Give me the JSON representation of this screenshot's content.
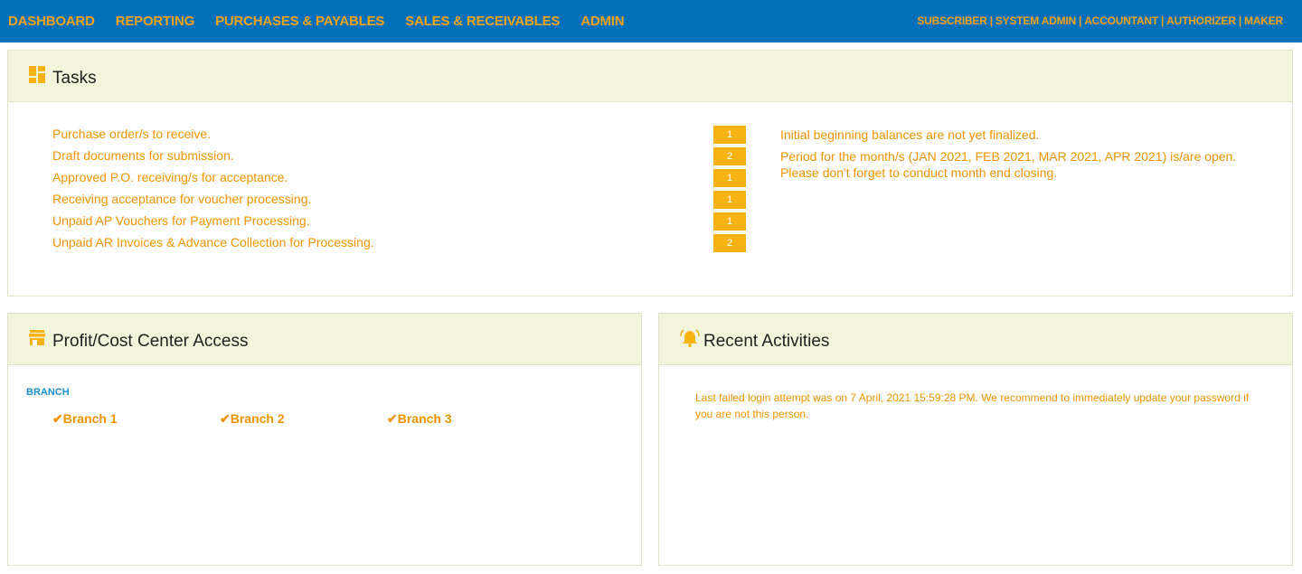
{
  "nav": {
    "items": [
      {
        "label": "DASHBOARD"
      },
      {
        "label": "REPORTING"
      },
      {
        "label": "PURCHASES & PAYABLES"
      },
      {
        "label": "SALES & RECEIVABLES"
      },
      {
        "label": "ADMIN"
      }
    ],
    "roles": [
      "SUBSCRIBER",
      "SYSTEM ADMIN",
      "ACCOUNTANT",
      "AUTHORIZER",
      "MAKER"
    ],
    "role_separator": "|"
  },
  "tasks": {
    "title": "Tasks",
    "items": [
      {
        "label": "Purchase order/s to receive.",
        "count": "1"
      },
      {
        "label": "Draft documents for submission.",
        "count": "2"
      },
      {
        "label": "Approved P.O. receiving/s for acceptance.",
        "count": "1"
      },
      {
        "label": "Receiving acceptance for voucher processing.",
        "count": "1"
      },
      {
        "label": "Unpaid AP Vouchers for Payment Processing.",
        "count": "1"
      },
      {
        "label": "Unpaid AR Invoices & Advance Collection for Processing.",
        "count": "2"
      }
    ],
    "notices": [
      "Initial beginning balances are not yet finalized.",
      "Period for the month/s (JAN 2021, FEB 2021, MAR 2021, APR 2021) is/are open. Please don't forget to conduct month end closing."
    ]
  },
  "profit_center": {
    "title": "Profit/Cost Center Access",
    "heading": "BRANCH",
    "check_mark": "✔",
    "branches": [
      "Branch 1",
      "Branch 2",
      "Branch 3"
    ]
  },
  "recent_activities": {
    "title": "Recent Activities",
    "message": "Last failed login attempt was on 7 April, 2021 15:59:28 PM. We recommend to immediately update your password if you are not this person."
  },
  "colors": {
    "topbar": "#0071b9",
    "accent": "#f29400",
    "badge": "#f7b313",
    "panel_header": "#f2f4dc",
    "branch_heading": "#1b8fd0"
  }
}
